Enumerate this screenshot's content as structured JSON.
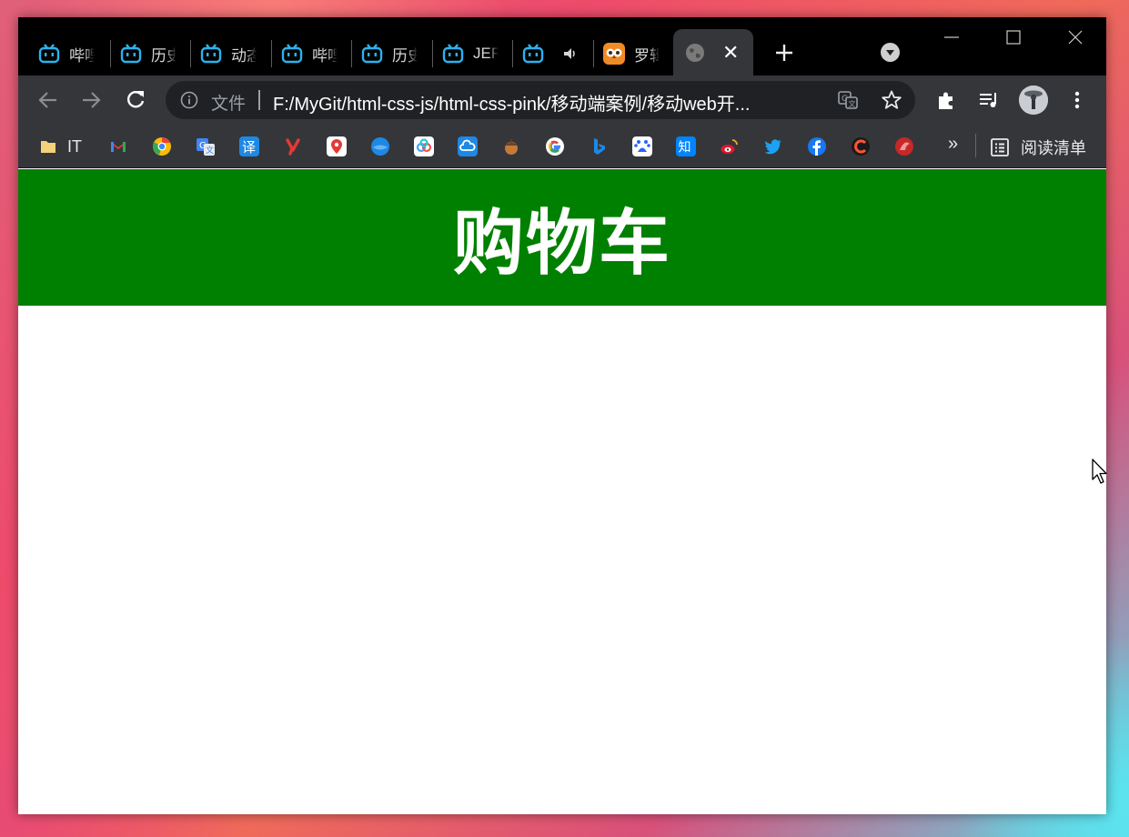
{
  "tabs": [
    {
      "title": "哔哩",
      "icon": "bilibili-icon"
    },
    {
      "title": "历史",
      "icon": "bilibili-icon"
    },
    {
      "title": "动态",
      "icon": "bilibili-icon"
    },
    {
      "title": "哔哩",
      "icon": "bilibili-icon"
    },
    {
      "title": "历史",
      "icon": "bilibili-icon"
    },
    {
      "title": "JER",
      "icon": "bilibili-icon"
    },
    {
      "title": "",
      "icon": "bilibili-icon",
      "audio": "speaker-icon"
    },
    {
      "title": "罗辑",
      "icon": "owl-icon"
    },
    {
      "title": "",
      "icon": "globe-icon",
      "active": true,
      "close": "✕"
    }
  ],
  "omnibox": {
    "scheme_label": "文件",
    "url": "F:/MyGit/html-css-js/html-css-pink/移动端案例/移动web开..."
  },
  "bookmarks": {
    "items": [
      {
        "label": "IT",
        "icon": "folder-icon",
        "color": "#f4d27a"
      },
      {
        "label": "",
        "icon": "gmail-icon",
        "color": "#ea4335"
      },
      {
        "label": "",
        "icon": "chrome-icon",
        "color": "#fbbc04"
      },
      {
        "label": "",
        "icon": "google-translate-icon",
        "color": "#4285f4"
      },
      {
        "label": "",
        "icon": "translate-yi-icon",
        "color": "#1e88e5"
      },
      {
        "label": "",
        "icon": "youdao-icon",
        "color": "#e53935"
      },
      {
        "label": "",
        "icon": "map-pin-icon",
        "color": "#e53935"
      },
      {
        "label": "",
        "icon": "earth-icon",
        "color": "#1e88e5"
      },
      {
        "label": "",
        "icon": "baidu-netdisk-icon",
        "color": "#42a5f5"
      },
      {
        "label": "",
        "icon": "cloud-icon",
        "color": "#1e88e5"
      },
      {
        "label": "",
        "icon": "acorn-icon",
        "color": "#a1662f"
      },
      {
        "label": "",
        "icon": "google-icon",
        "color": "#4285f4"
      },
      {
        "label": "",
        "icon": "bing-icon",
        "color": "#1e88e5"
      },
      {
        "label": "",
        "icon": "baidu-icon",
        "color": "#2962ff"
      },
      {
        "label": "",
        "icon": "zhihu-icon",
        "color": "#0084ff"
      },
      {
        "label": "",
        "icon": "weibo-icon",
        "color": "#e6162d"
      },
      {
        "label": "",
        "icon": "twitter-icon",
        "color": "#1da1f2"
      },
      {
        "label": "",
        "icon": "facebook-icon",
        "color": "#1877f2"
      },
      {
        "label": "",
        "icon": "csdn-icon",
        "color": "#fc5531"
      },
      {
        "label": "",
        "icon": "app-red-icon",
        "color": "#e53935"
      }
    ],
    "overflow": "»",
    "reading_list": "阅读清单"
  },
  "page": {
    "title": "购物车",
    "header_color": "#008000"
  }
}
